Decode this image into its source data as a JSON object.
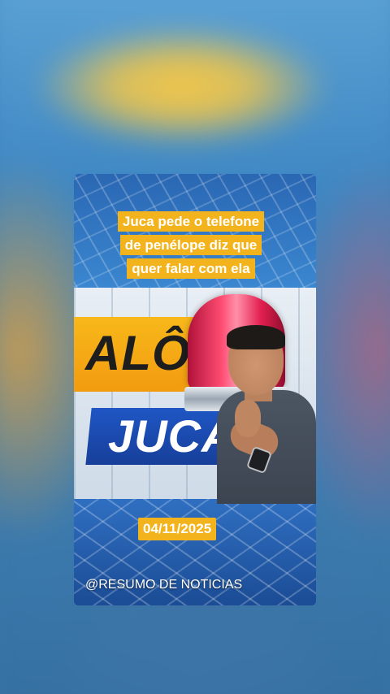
{
  "video": {
    "headline_lines": [
      "Juca pede o telefone",
      "de penélope diz que",
      "quer falar com ela"
    ],
    "logo_alo": "ALÔ",
    "logo_juca": "JUCA",
    "date": "04/11/2025",
    "watermark": "@RESUMO DE NOTICIAS"
  },
  "colors": {
    "caption_highlight": "#f3b31d",
    "logo_blue": "#1f56c4",
    "logo_orange": "#f29b10",
    "siren_red": "#e22050"
  }
}
